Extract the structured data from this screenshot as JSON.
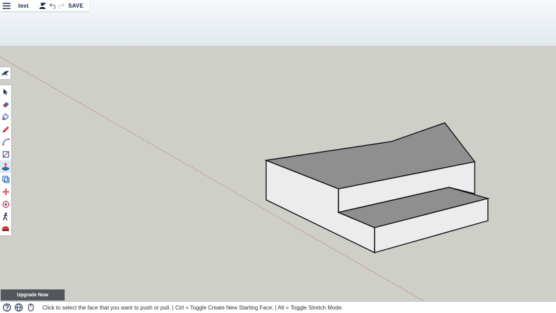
{
  "header": {
    "doc_title": "test",
    "save_label": "SAVE",
    "icons": [
      "hamburger-menu-icon",
      "user-icon",
      "undo-icon",
      "redo-icon"
    ]
  },
  "sidebar": {
    "top_tool": "instructor-tool",
    "tools": [
      "select-tool",
      "eraser-tool",
      "paint-bucket-tool",
      "pencil-tool",
      "arc-tool",
      "rectangle-tool",
      "push-pull-tool",
      "offset-tool",
      "move-tool",
      "orbit-tool",
      "walk-tool",
      "tape-measure-tool"
    ],
    "active_tool": "push-pull-tool"
  },
  "footer": {
    "upgrade_label": "Upgrade Now",
    "status_text": "Click to select the face that you want to push or pull.  |  Ctrl = Toggle Create New Starting Face.  |  Alt = Toggle Stretch Mode.",
    "icons": [
      "help-icon",
      "globe-icon",
      "mouse-icon"
    ]
  },
  "colors": {
    "sky_top": "#f7f9fb",
    "sky_bottom": "#e1e8ef",
    "ground": "#cfcfca",
    "face_top": "#8f8f8f",
    "face_side": "#ececec",
    "accent_red": "#d63a3a",
    "accent_blue": "#2b6fb6"
  }
}
